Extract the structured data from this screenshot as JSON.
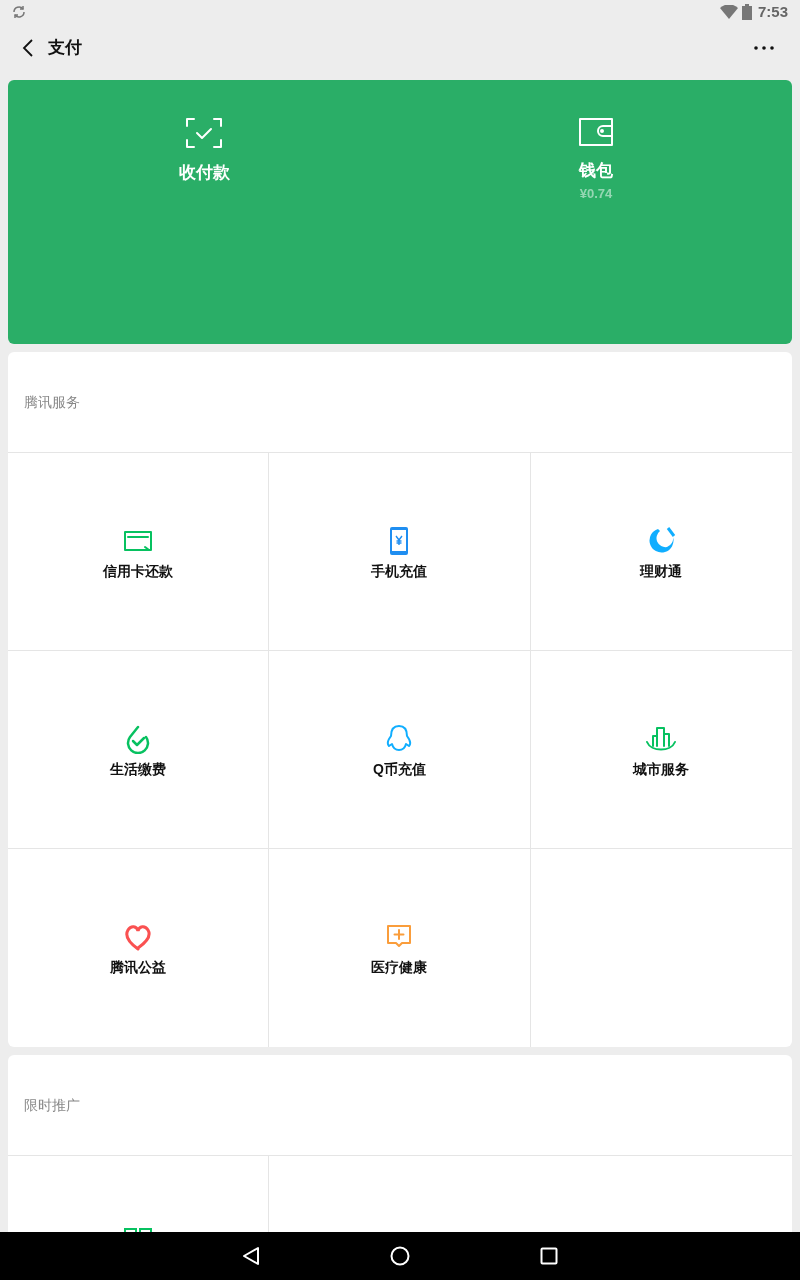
{
  "status_bar": {
    "time": "7:53"
  },
  "header": {
    "title": "支付"
  },
  "wallet_card": [
    {
      "label": "收付款"
    },
    {
      "label": "钱包",
      "sub": "¥0.74"
    }
  ],
  "tencent_services": {
    "title": "腾讯服务",
    "items": [
      {
        "label": "信用卡还款"
      },
      {
        "label": "手机充值"
      },
      {
        "label": "理财通"
      },
      {
        "label": "生活缴费"
      },
      {
        "label": "Q币充值"
      },
      {
        "label": "城市服务"
      },
      {
        "label": "腾讯公益"
      },
      {
        "label": "医疗健康"
      }
    ]
  },
  "promotions": {
    "title": "限时推广"
  }
}
